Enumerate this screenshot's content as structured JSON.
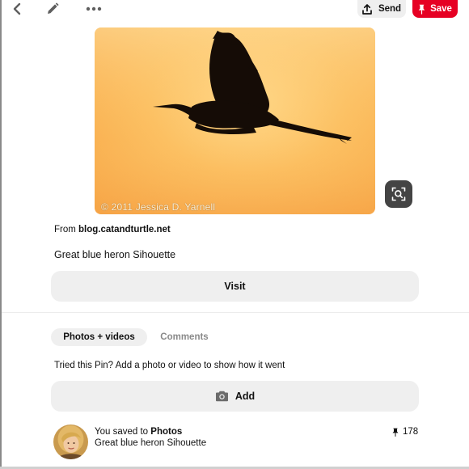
{
  "toolbar": {
    "back_icon": "chevron-left-icon",
    "edit_icon": "pencil-icon",
    "more_icon": "ellipsis-icon",
    "send_label": "Send",
    "send_icon": "share-upload-icon",
    "save_label": "Save",
    "save_icon": "pushpin-icon",
    "save_color": "#e60023"
  },
  "pin": {
    "image_subject": "heron-silhouette",
    "watermark": "© 2011 Jessica D. Yarnell",
    "lens_icon": "visual-search-icon",
    "source_prefix": "From ",
    "source_domain": "blog.catandturtle.net",
    "title": "Great blue heron Sihouette",
    "visit_label": "Visit"
  },
  "tabs": [
    {
      "label": "Photos + videos",
      "active": true
    },
    {
      "label": "Comments",
      "active": false
    }
  ],
  "tried": {
    "prompt": "Tried this Pin? Add a photo or video to show how it went",
    "add_label": "Add",
    "add_icon": "camera-icon"
  },
  "activity": {
    "saved_prefix": "You saved to ",
    "board": "Photos",
    "pin_title": "Great blue heron Sihouette",
    "save_count": "178",
    "count_icon": "pushpin-icon"
  },
  "colors": {
    "button_bg": "#efefef",
    "lens_bg": "#444444",
    "muted_text": "#8a8a8a"
  }
}
